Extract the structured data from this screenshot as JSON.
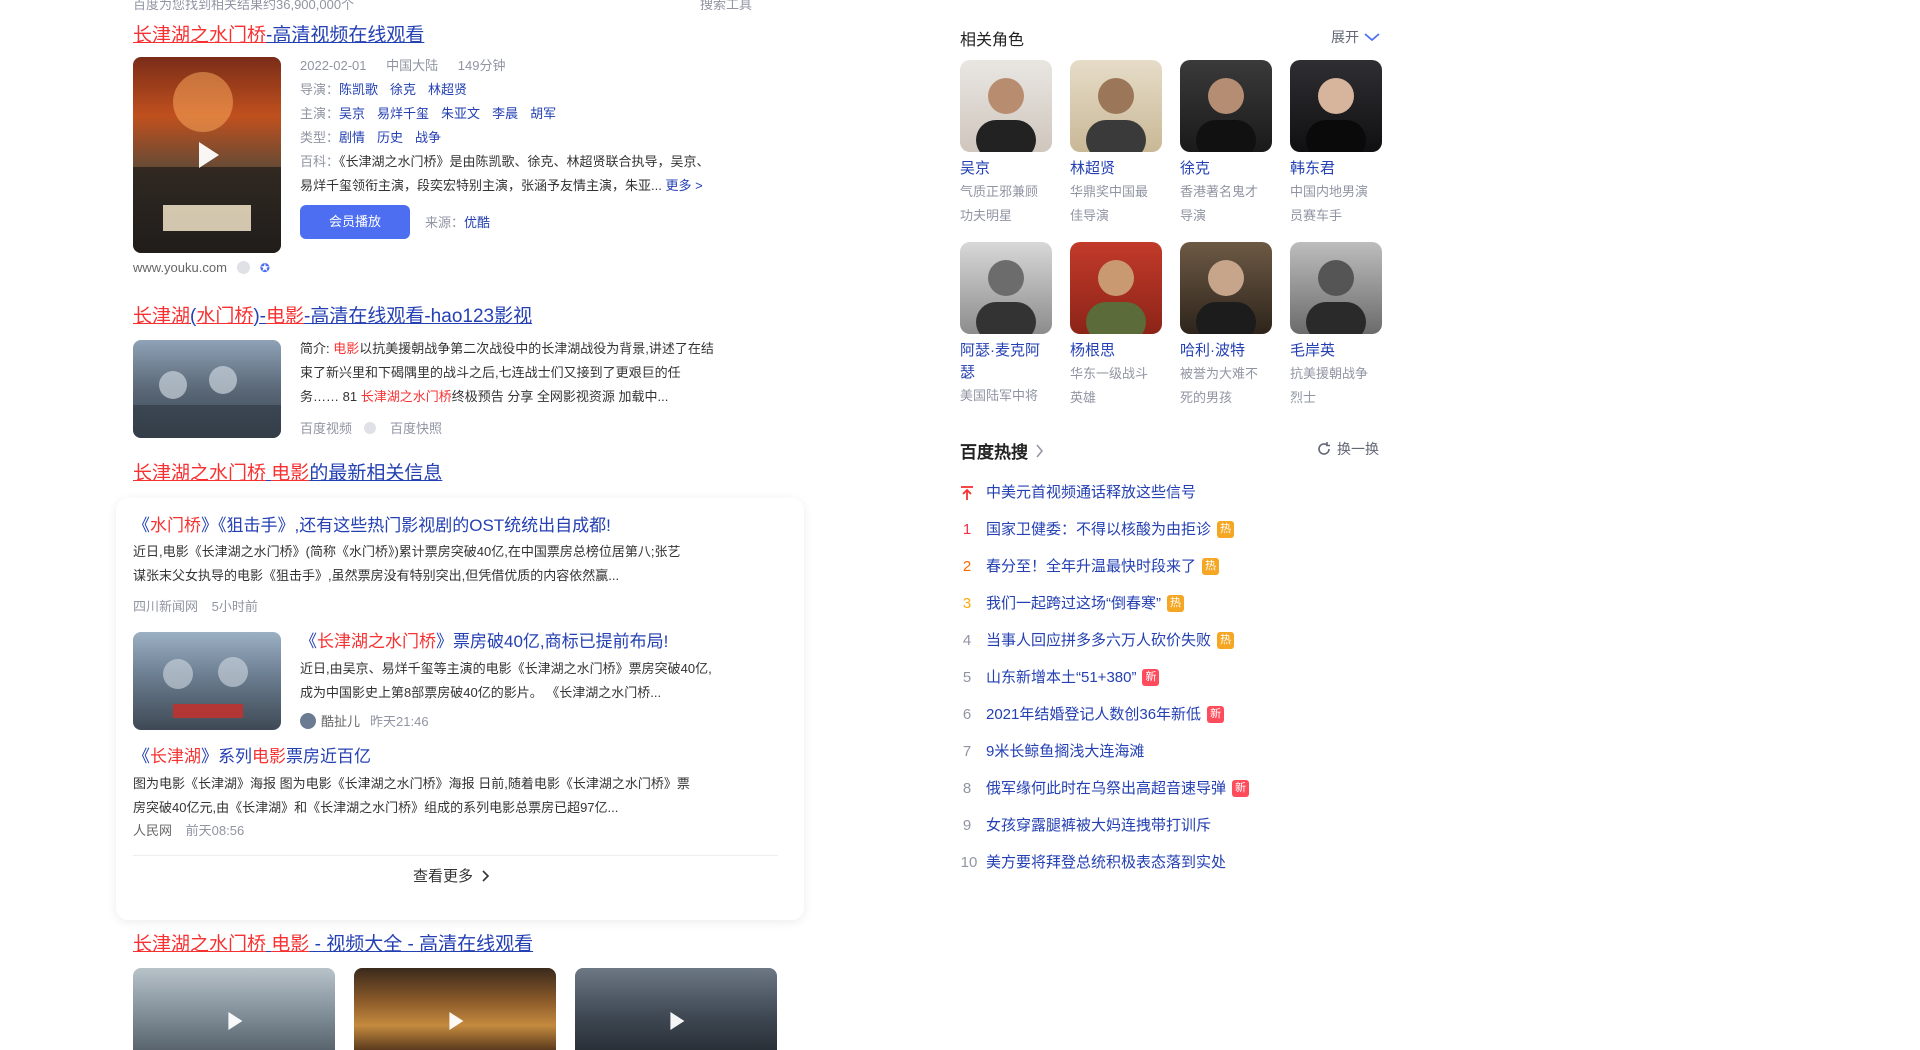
{
  "top_cut_left": "百度为您找到相关结果约36,900,000个",
  "top_cut_right": "搜索工具",
  "result1": {
    "title_hl": "长津湖之水门桥",
    "title_rest": "-高清视频在线观看",
    "date": "2022-02-01",
    "region": "中国大陆",
    "duration": "149分钟",
    "director_label": "导演：",
    "directors": [
      "陈凯歌",
      "徐克",
      "林超贤"
    ],
    "cast_label": "主演：",
    "cast": [
      "吴京",
      "易烊千玺",
      "朱亚文",
      "李晨",
      "胡军"
    ],
    "genre_label": "类型：",
    "genres": [
      "剧情",
      "历史",
      "战争"
    ],
    "wiki_label": "百科：",
    "wiki_line1": "《长津湖之水门桥》是由陈凯歌、徐克、林超贤联合执导，吴京、",
    "wiki_line2": "易烊千玺领衔主演，段奕宏特别主演，张涵予友情主演，朱亚...",
    "more": "更多 >",
    "member_btn": "会员播放",
    "source_label": "来源：",
    "source": "优酷",
    "url": "www.youku.com"
  },
  "result2": {
    "title_p1": "长津湖",
    "title_p2": "(",
    "title_p3": "水门桥",
    "title_p4": ")-",
    "title_p5": "电影",
    "title_p6": "-高清在线观看-hao123影视",
    "line1_pre": "简介: ",
    "line1_hl": "电影",
    "line1_rest": "以抗美援朝战争第二次战役中的长津湖战役为背景,讲述了在结",
    "line2": "束了新兴里和下碣隅里的战斗之后,七连战士们又接到了更艰巨的任",
    "line3_pre": "务…… 81 ",
    "line3_hl": "长津湖之水门桥",
    "line3_rest": "终极预告 分享 全网影视资源 加载中...",
    "src1": "百度视频",
    "src2": "百度快照"
  },
  "news_heading": {
    "hl1": "长津湖之水门桥",
    "sp": " ",
    "hl2": "电影",
    "rest": "的最新相关信息"
  },
  "news": [
    {
      "t1": "《",
      "thl1": "水门桥",
      "t2": "》《狙击手》,还有这些热门影视剧的OST统统出自成都!",
      "body1": "近日,电影《长津湖之水门桥》(简称《水门桥》)累计票房突破40亿,在中国票房总榜位居第八;张艺",
      "body2": "谋张末父女执导的电影《狙击手》,虽然票房没有特别突出,但凭借优质的内容依然赢...",
      "source": "四川新闻网",
      "time": "5小时前"
    },
    {
      "t1": "《",
      "thl1": "长津湖之水门桥",
      "t2": "》票房破40亿,商标已提前布局!",
      "body1": "近日,由吴京、易烊千玺等主演的电影《长津湖之水门桥》票房突破40亿,",
      "body2": "成为中国影史上第8部票房破40亿的影片。 《长津湖之水门桥...",
      "source": "酷扯儿",
      "time": "昨天21:46"
    },
    {
      "t1": "《",
      "thl1": "长津湖",
      "t2": "》系列",
      "thl2": "电影",
      "t3": "票房近百亿",
      "body1": "图为电影《长津湖》海报 图为电影《长津湖之水门桥》海报 日前,随着电影《长津湖之水门桥》票",
      "body2": "房突破40亿元,由《长津湖》和《长津湖之水门桥》组成的系列电影总票房已超97亿...",
      "source": "人民网",
      "time": "前天08:56"
    }
  ],
  "see_more": "查看更多",
  "result4": {
    "title_hl1": "长津湖之水门桥",
    "title_sp": " ",
    "title_hl2": "电影",
    "title_rest": " - 视频大全 - 高清在线观看"
  },
  "related": {
    "heading": "相关角色",
    "expand": "展开",
    "people": [
      {
        "name": "吴京",
        "d1": "气质正邪兼顾",
        "d2": "功夫明星"
      },
      {
        "name": "林超贤",
        "d1": "华鼎奖中国最",
        "d2": "佳导演"
      },
      {
        "name": "徐克",
        "d1": "香港著名鬼才",
        "d2": "导演"
      },
      {
        "name": "韩东君",
        "d1": "中国内地男演",
        "d2": "员赛车手"
      },
      {
        "name": "阿瑟·麦克阿",
        "name2": "瑟",
        "d1": "美国陆军中将",
        "d2": ""
      },
      {
        "name": "杨根思",
        "d1": "华东一级战斗",
        "d2": "英雄"
      },
      {
        "name": "哈利·波特",
        "d1": "被誉为大难不",
        "d2": "死的男孩"
      },
      {
        "name": "毛岸英",
        "d1": "抗美援朝战争",
        "d2": "烈士"
      }
    ]
  },
  "hot": {
    "heading": "百度热搜",
    "refresh": "换一换",
    "items": [
      {
        "rank": "",
        "title": "中美元首视频通话释放这些信号",
        "badge": ""
      },
      {
        "rank": "1",
        "title": "国家卫健委：不得以核酸为由拒诊",
        "badge": "热"
      },
      {
        "rank": "2",
        "title": "春分至！全年升温最快时段来了",
        "badge": "热"
      },
      {
        "rank": "3",
        "title": "我们一起跨过这场“倒春寒”",
        "badge": "热"
      },
      {
        "rank": "4",
        "title": "当事人回应拼多多六万人砍价失败",
        "badge": "热"
      },
      {
        "rank": "5",
        "title": "山东新增本土“51+380”",
        "badge": "新"
      },
      {
        "rank": "6",
        "title": "2021年结婚登记人数创36年新低",
        "badge": "新"
      },
      {
        "rank": "7",
        "title": "9米长鲸鱼搁浅大连海滩",
        "badge": ""
      },
      {
        "rank": "8",
        "title": "俄军缘何此时在乌祭出高超音速导弹",
        "badge": "新"
      },
      {
        "rank": "9",
        "title": "女孩穿露腿裤被大妈连拽带打训斥",
        "badge": ""
      },
      {
        "rank": "10",
        "title": "美方要将拜登总统积极表态落到实处",
        "badge": ""
      }
    ]
  },
  "colors": {
    "link": "#2440b3",
    "highlight": "#f73131",
    "accent": "#4e6ef2",
    "hot_badge": "#f5a623",
    "new_badge": "#fe4c5c"
  }
}
